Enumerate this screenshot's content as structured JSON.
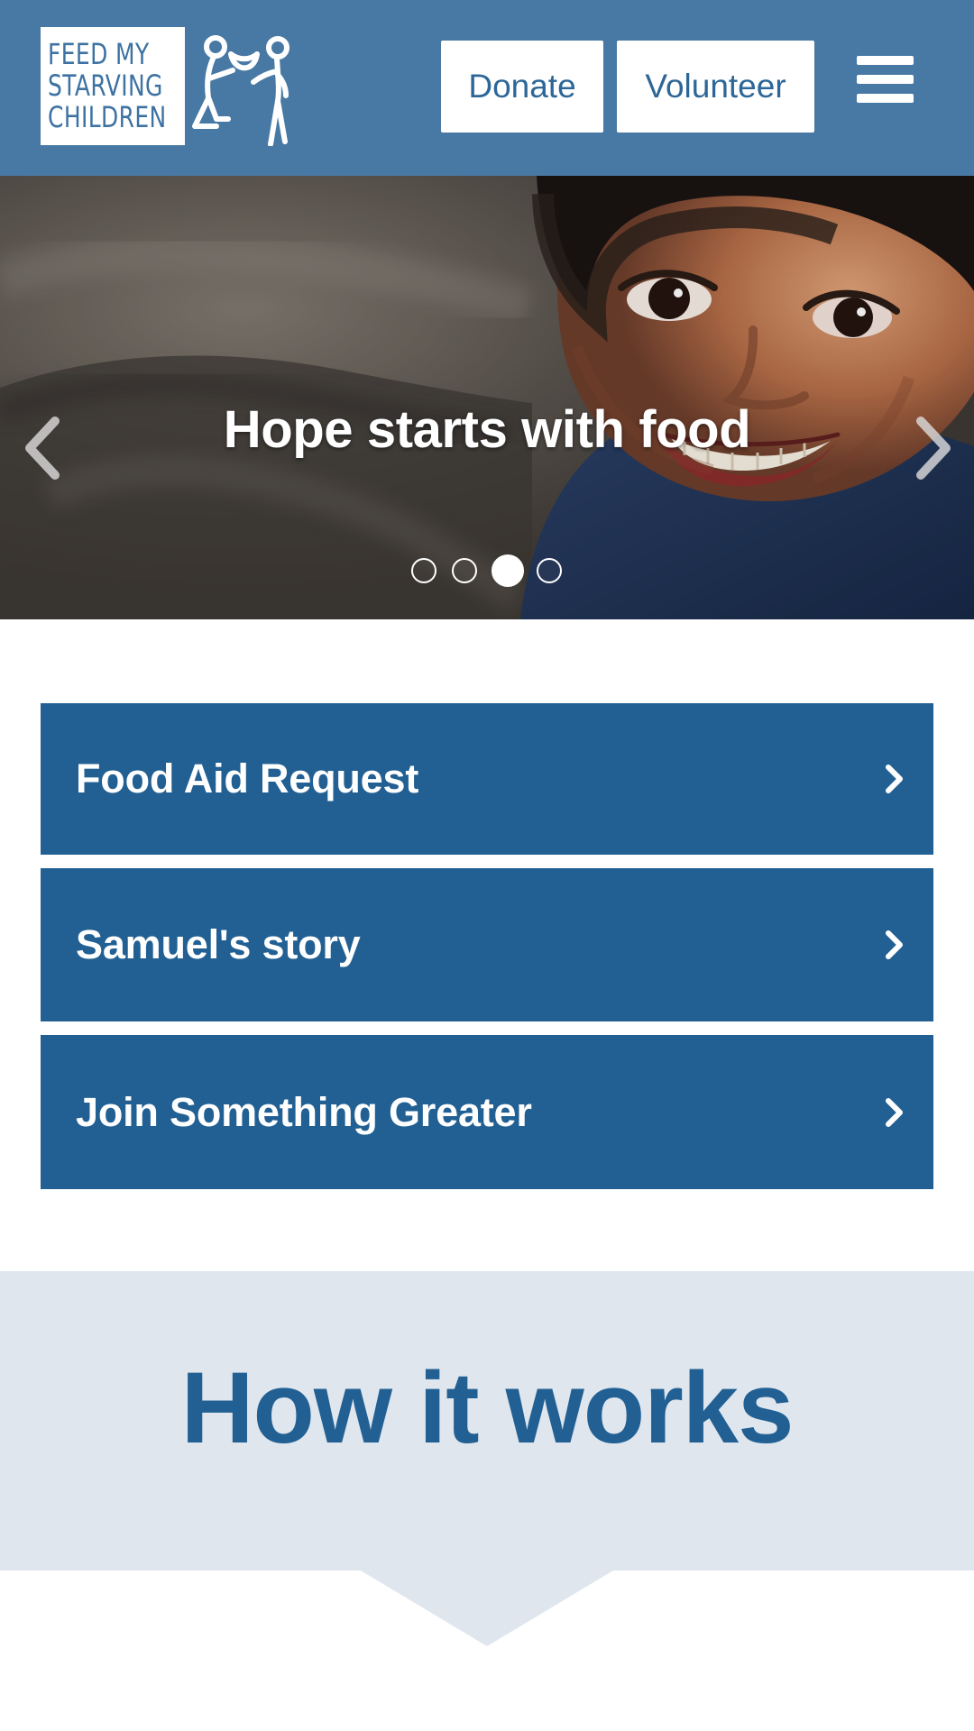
{
  "header": {
    "logo_lines": [
      "FEED MY",
      "STARVING",
      "CHILDREN"
    ],
    "donate_label": "Donate",
    "volunteer_label": "Volunteer",
    "menu_icon": "hamburger-menu-icon",
    "background_color": "#4779a4"
  },
  "hero": {
    "title": "Hope starts with food",
    "previous_icon": "chevron-left-icon",
    "next_icon": "chevron-right-icon",
    "active_slide": 3,
    "slide_count": 4
  },
  "quick_links": [
    {
      "label": "Food Aid Request",
      "icon": "chevron-right-icon"
    },
    {
      "label": "Samuel's story",
      "icon": "chevron-right-icon"
    },
    {
      "label": "Join Something Greater",
      "icon": "chevron-right-icon"
    }
  ],
  "how_it_works": {
    "title": "How it works"
  },
  "colors": {
    "accent": "#226093",
    "header": "#4779a4",
    "section_background": "#dfe6ee"
  }
}
